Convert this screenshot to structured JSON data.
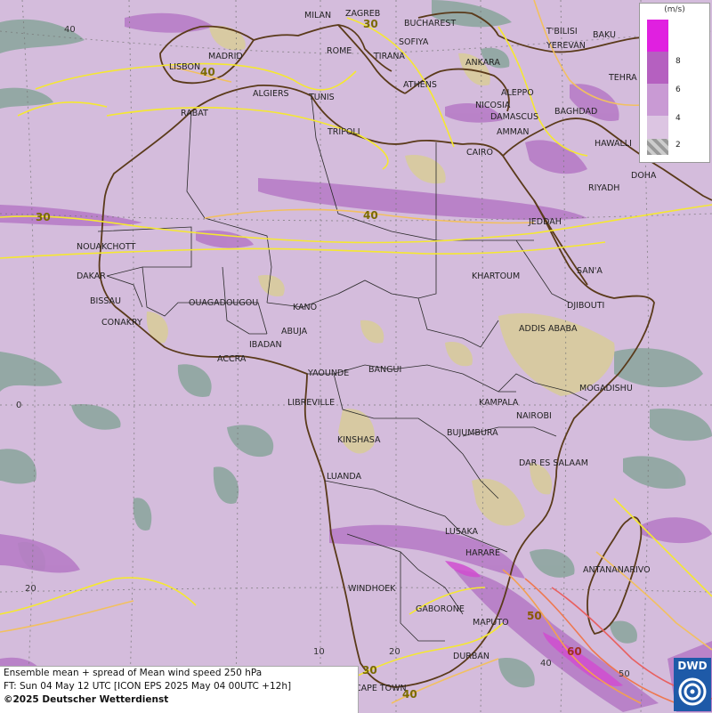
{
  "legend": {
    "unit": "(m/s)",
    "ticks": [
      "8",
      "6",
      "4",
      "2"
    ],
    "colors": [
      "#e020e0",
      "#b560c0",
      "#c99ad4",
      "#dcc5e2",
      "#aaaaaa"
    ]
  },
  "info": {
    "line1": "Ensemble mean + spread of Mean wind speed 250 hPa",
    "line2": "FT: Sun 04 May 12 UTC [ICON EPS 2025 May 04 00UTC +12h]",
    "line3": "©2025 Deutscher Wetterdienst"
  },
  "logo": {
    "text": "DWD"
  },
  "grid_labels": {
    "lat_40": "40",
    "lat_0": "0",
    "lat_20": "20",
    "lon_10": "10",
    "lon_20": "20",
    "lon_40": "40",
    "lon_50": "50"
  },
  "contour_labels": {
    "c30_west": "30",
    "c40_lisbon": "40",
    "c30_north": "30",
    "c40_sahara": "40",
    "c50_south": "50",
    "c60_south": "60",
    "c30_cape": "30",
    "c40_cape": "40"
  },
  "cities": {
    "milan": "MILAN",
    "zagreb": "ZAGREB",
    "bucharest": "BUCHAREST",
    "tbilisi": "T'BILISI",
    "baku": "BAKU",
    "yerevan": "YEREVAN",
    "sofiya": "SOFIYA",
    "tehran": "TEHRA",
    "madrid": "MADRID",
    "rome": "ROME",
    "tirana": "TIRANA",
    "ankara": "ANKARA",
    "lisbon": "LISBON",
    "algiers": "ALGIERS",
    "tunis": "TUNIS",
    "athens": "ATHENS",
    "aleppo": "ALEPPO",
    "rabat": "RABAT",
    "nicosia": "NICOSIA",
    "baghdad": "BAGHDAD",
    "damascus": "DAMASCUS",
    "amman": "AMMAN",
    "tripoli": "TRIPOLI",
    "hawalli": "HAWALLI",
    "cairo": "CAIRO",
    "doha": "DOHA",
    "riyadh": "RIYADH",
    "jeddah": "JEDDAH",
    "nouakchott": "NOUAKCHOTT",
    "dakar": "DAKAR",
    "sana": "SAN'A",
    "khartoum": "KHARTOUM",
    "bissau": "BISSAU",
    "ouagadougou": "OUAGADOUGOU",
    "djibouti": "DJIBOUTI",
    "kano": "KANO",
    "conakry": "CONAKRY",
    "abuja": "ABUJA",
    "addis": "ADDIS ABABA",
    "ibadan": "IBADAN",
    "accra": "ACCRA",
    "yaounde": "YAOUNDE",
    "bangui": "BANGUI",
    "mogadishu": "MOGADISHU",
    "libreville": "LIBREVILLE",
    "kampala": "KAMPALA",
    "nairobi": "NAIROBI",
    "kinshasa": "KINSHASA",
    "bujumbura": "BUJUMBURA",
    "dares": "DAR ES SALAAM",
    "luanda": "LUANDA",
    "lusaka": "LUSAKA",
    "harare": "HARARE",
    "antananarivo": "ANTANANARIVO",
    "windhoek": "WINDHOEK",
    "gaborone": "GABORONE",
    "maputo": "MAPUTO",
    "durban": "DURBAN",
    "capetown": "CAPE TOWN"
  }
}
